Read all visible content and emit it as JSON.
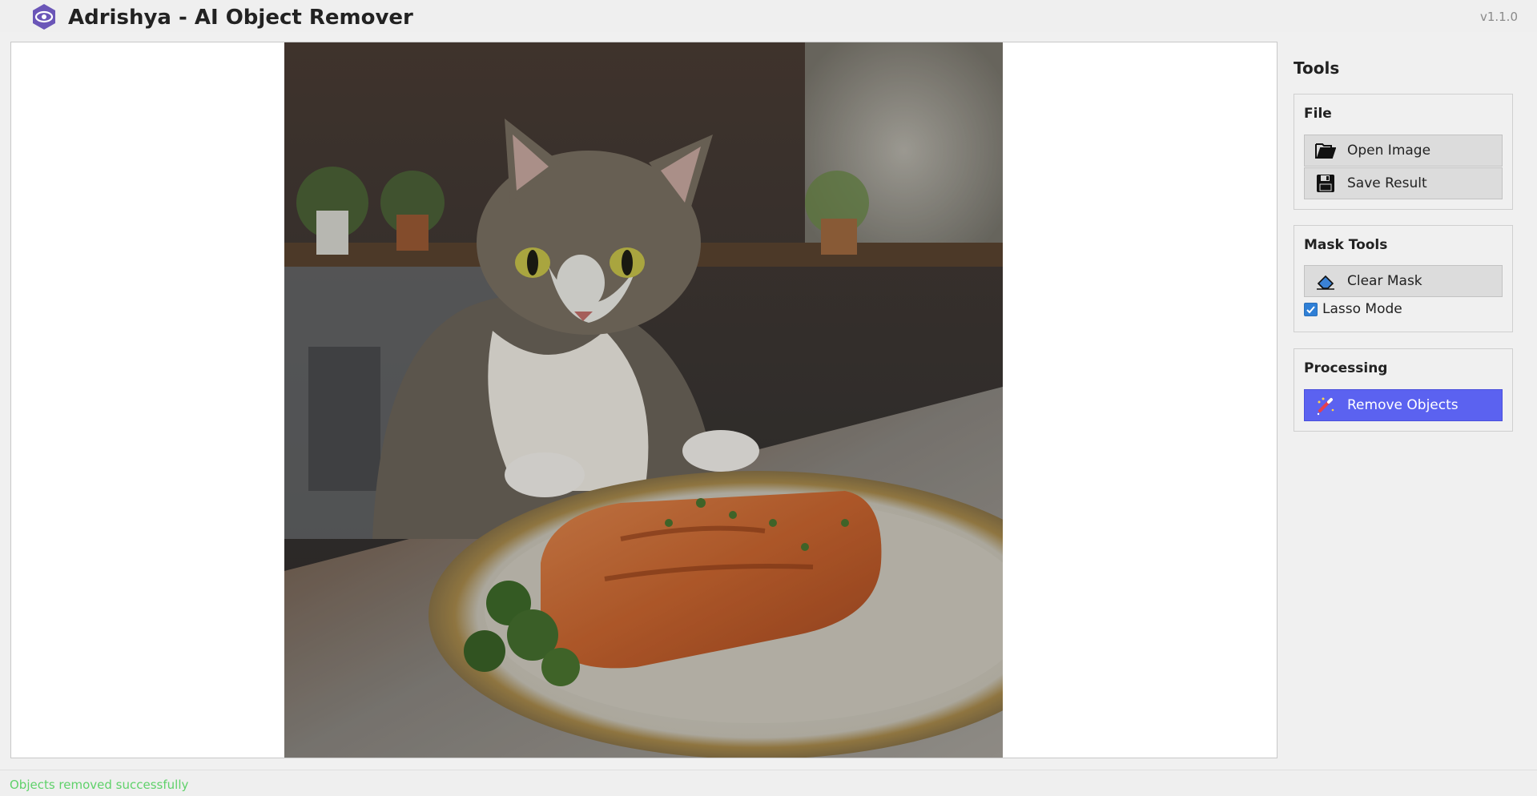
{
  "app": {
    "title": "Adrishya - AI Object Remover",
    "version": "v1.1.0",
    "logo_icon": "eye-icon",
    "logo_color": "#6b56b8"
  },
  "canvas": {
    "image_description_icon": "cat-salmon-photo"
  },
  "tools": {
    "title": "Tools",
    "file": {
      "title": "File",
      "open_label": "Open Image",
      "open_icon": "folder-open-icon",
      "save_label": "Save Result",
      "save_icon": "floppy-disk-icon"
    },
    "mask": {
      "title": "Mask Tools",
      "clear_label": "Clear Mask",
      "clear_icon": "eraser-icon",
      "lasso_label": "Lasso Mode",
      "lasso_checked": true
    },
    "processing": {
      "title": "Processing",
      "remove_label": "Remove Objects",
      "remove_icon": "magic-wand-icon",
      "accent": "#5b62f0"
    }
  },
  "status": {
    "text": "Objects removed successfully",
    "color": "#5fd16a"
  }
}
